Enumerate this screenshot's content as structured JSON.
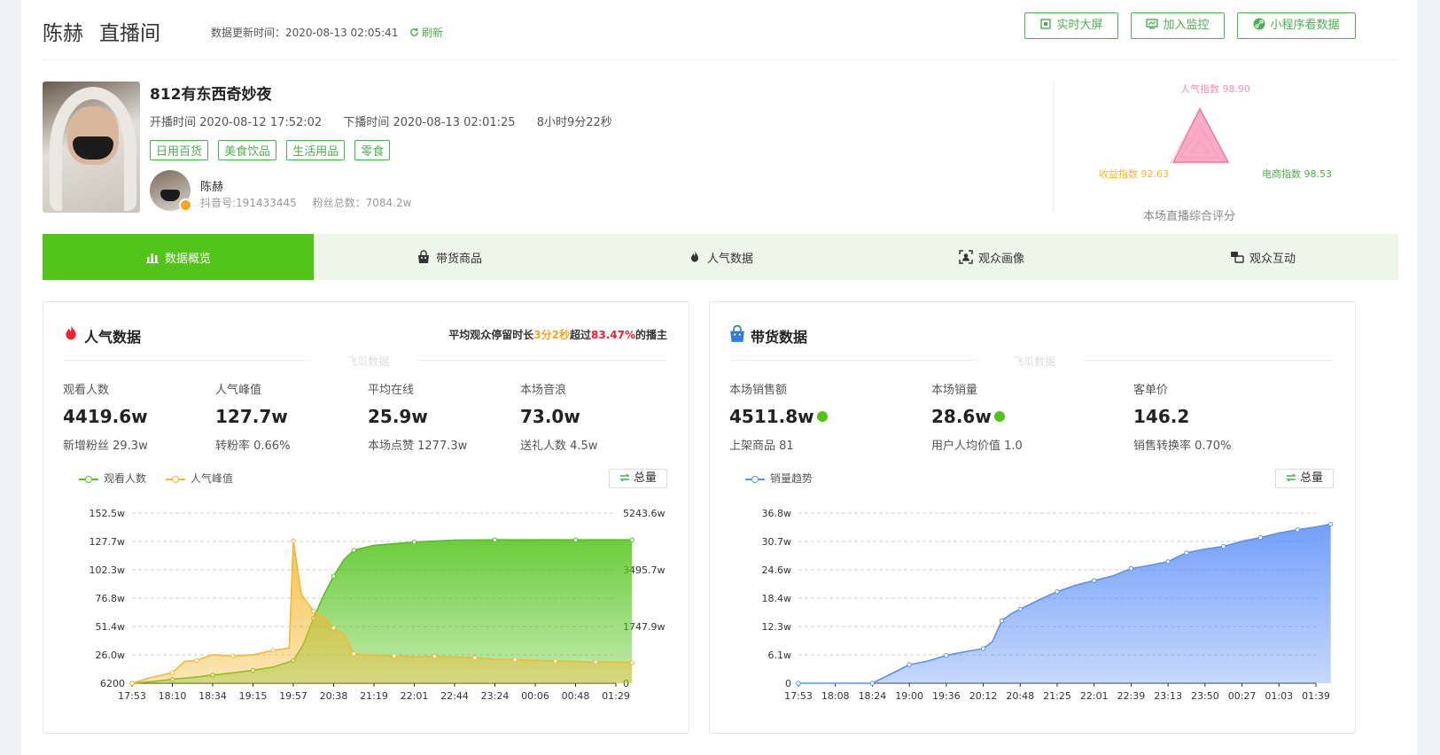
{
  "header": {
    "anchor_name": "陈赫",
    "room_label": "直播间",
    "update_time": "数据更新时间：2020-08-13 02:05:41",
    "refresh_label": "刷新",
    "buttons": [
      "实时大屏",
      "加入监控",
      "小程序看数据"
    ]
  },
  "live": {
    "title": "812有东西奇妙夜",
    "start": "开播时间 2020-08-12 17:52:02",
    "end": "下播时间 2020-08-13 02:01:25",
    "duration": "8小时9分22秒",
    "tags": [
      "日用百货",
      "美食饮品",
      "生活用品",
      "零食"
    ],
    "anchor": "陈赫",
    "douyin_id": "抖音号:191433445",
    "fans": "粉丝总数：7084.2w"
  },
  "radar": {
    "popularity": "人气指数 98.90",
    "revenue": "收益指数 92.63",
    "ecommerce": "电商指数 98.53",
    "caption": "本场直播综合评分",
    "colors": {
      "popularity": "#f48fb1",
      "revenue": "#f5b82e",
      "ecommerce": "#4caf50"
    }
  },
  "tabs": [
    "数据概览",
    "带货商品",
    "人气数据",
    "观众画像",
    "观众互动"
  ],
  "popularity_panel": {
    "title": "人气数据",
    "note_pre": "平均观众停留时长",
    "note_time": "3分2秒",
    "note_mid": "超过",
    "note_pct": "83.47%",
    "note_post": "的播主",
    "watermark": "飞瓜数据",
    "stats": [
      {
        "label": "观看人数",
        "value": "4419.6w",
        "sub": "新增粉丝 29.3w"
      },
      {
        "label": "人气峰值",
        "value": "127.7w",
        "sub": "转粉率 0.66%"
      },
      {
        "label": "平均在线",
        "value": "25.9w",
        "sub": "本场点赞 1277.3w"
      },
      {
        "label": "本场音浪",
        "value": "73.0w",
        "sub": "送礼人数 4.5w"
      }
    ],
    "legend": [
      "观看人数",
      "人气峰值"
    ],
    "total_label": "总量"
  },
  "sales_panel": {
    "title": "带货数据",
    "watermark": "飞瓜数据",
    "stats": [
      {
        "label": "本场销售额",
        "value": "4511.8w",
        "sub": "上架商品 81"
      },
      {
        "label": "本场销量",
        "value": "28.6w",
        "sub": "用户人均价值 1.0"
      },
      {
        "label": "客单价",
        "value": "146.2",
        "sub": "销售转换率 0.70%"
      }
    ],
    "legend": [
      "销量趋势"
    ],
    "total_label": "总量"
  },
  "chart_data": [
    {
      "type": "area",
      "categories": [
        "17:53",
        "18:10",
        "18:34",
        "19:15",
        "19:57",
        "20:38",
        "21:19",
        "22:01",
        "22:44",
        "23:24",
        "00:06",
        "00:48",
        "01:29"
      ],
      "left_ticks": [
        "6200",
        "26.0w",
        "51.4w",
        "76.8w",
        "102.3w",
        "127.7w",
        "152.5w"
      ],
      "right_ticks": [
        "0",
        "1747.9w",
        "3495.7w",
        "5243.6w"
      ],
      "left_ylim": [
        6200,
        1525000
      ],
      "right_ylim": [
        0,
        52436000
      ],
      "series": [
        {
          "name": "观看人数",
          "axis": "right",
          "color": "#52c41a",
          "x": [
            0,
            0.5,
            1,
            1.5,
            2,
            2.5,
            3,
            3.5,
            4,
            4.25,
            4.5,
            4.75,
            5,
            5.25,
            5.5,
            6,
            7,
            8,
            9,
            10,
            11,
            12,
            12.4
          ],
          "values": [
            0,
            500000,
            1200000,
            1800000,
            2500000,
            3200000,
            4000000,
            5000000,
            7000000,
            12000000,
            20000000,
            27000000,
            33000000,
            38000000,
            41000000,
            42500000,
            43500000,
            44100000,
            44196000,
            44196000,
            44196000,
            44196000,
            44196000
          ]
        },
        {
          "name": "人气峰值",
          "axis": "left",
          "color": "#f5b82e",
          "x": [
            0,
            0.5,
            1,
            1.3,
            1.6,
            2,
            2.5,
            3,
            3.5,
            3.9,
            4.0,
            4.2,
            4.5,
            4.75,
            5,
            5.25,
            5.5,
            6,
            6.5,
            7,
            7.5,
            8,
            8.5,
            9,
            9.5,
            10,
            10.5,
            11,
            11.5,
            12,
            12.4
          ],
          "values": [
            6200,
            60000,
            100000,
            200000,
            210000,
            260000,
            250000,
            260000,
            300000,
            320000,
            1277000,
            800000,
            650000,
            600000,
            500000,
            450000,
            270000,
            255000,
            250000,
            240000,
            245000,
            240000,
            235000,
            220000,
            215000,
            210000,
            205000,
            200000,
            195000,
            195000,
            190000
          ]
        }
      ]
    },
    {
      "type": "area",
      "categories": [
        "17:53",
        "18:08",
        "18:24",
        "19:00",
        "19:36",
        "20:12",
        "20:48",
        "21:25",
        "22:01",
        "22:39",
        "23:13",
        "23:50",
        "00:27",
        "01:03",
        "01:39"
      ],
      "left_ticks": [
        "0",
        "6.1w",
        "12.3w",
        "18.4w",
        "24.6w",
        "30.7w",
        "36.8w"
      ],
      "ylim": [
        0,
        368000
      ],
      "series": [
        {
          "name": "销量趋势",
          "color": "#5b8ff9",
          "x": [
            0,
            1,
            2,
            2.5,
            3,
            3.5,
            4,
            4.5,
            5,
            5.25,
            5.5,
            5.75,
            6,
            6.5,
            7,
            7.5,
            8,
            8.5,
            9,
            9.5,
            10,
            10.3,
            10.5,
            11,
            11.5,
            12,
            12.5,
            13,
            13.5,
            14,
            14.4
          ],
          "values": [
            0,
            0,
            0,
            20000,
            40000,
            48000,
            60000,
            68000,
            75000,
            90000,
            135000,
            150000,
            160000,
            180000,
            198000,
            212000,
            222000,
            232000,
            248000,
            255000,
            263000,
            275000,
            282000,
            290000,
            296000,
            307000,
            315000,
            325000,
            332000,
            338000,
            344000
          ]
        }
      ]
    }
  ]
}
